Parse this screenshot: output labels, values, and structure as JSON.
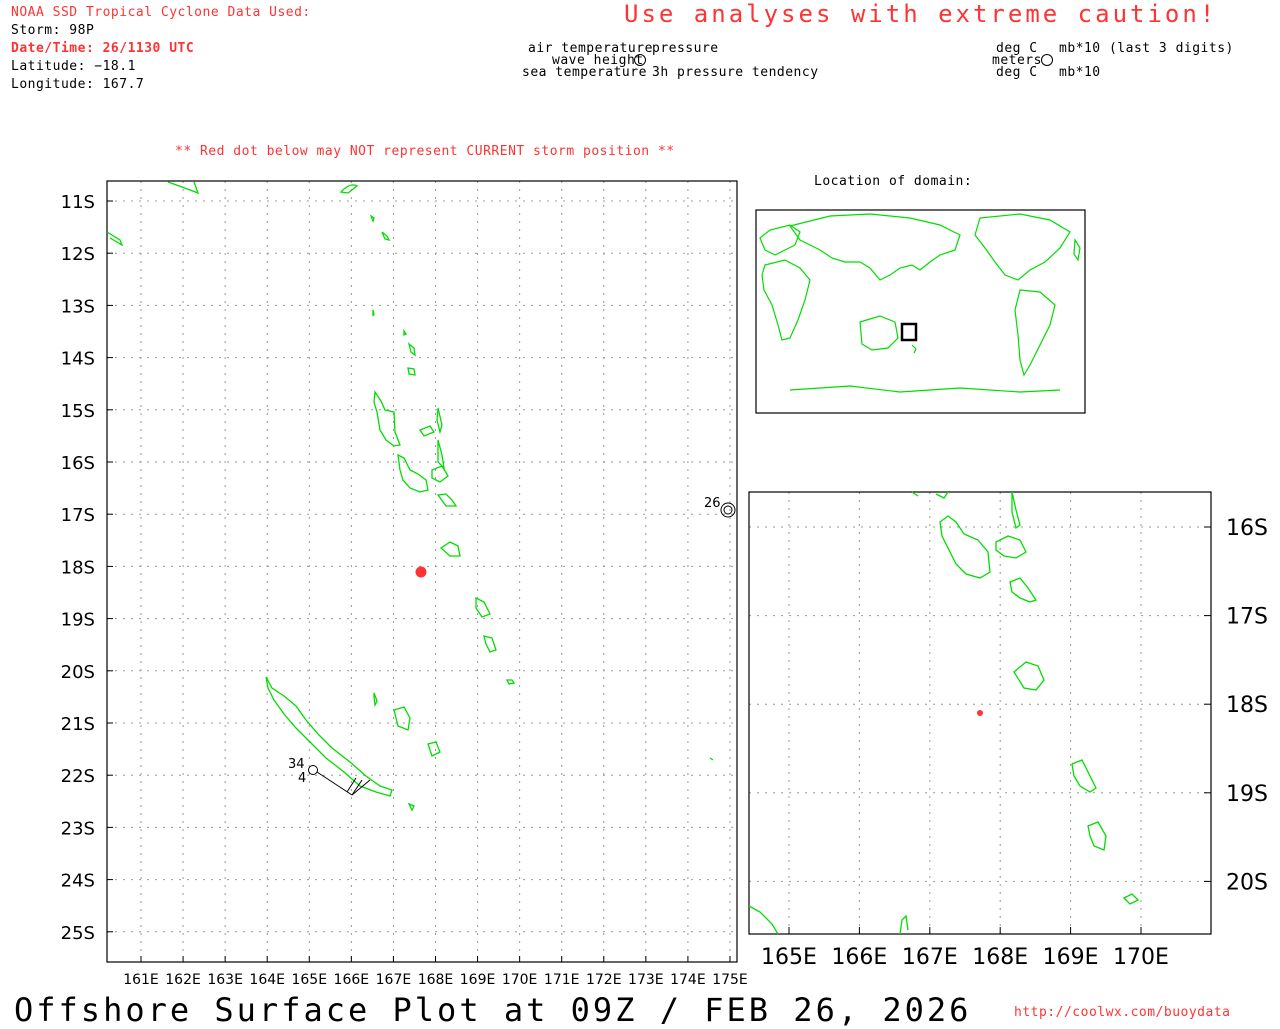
{
  "header": {
    "source_title": "NOAA SSD Tropical Cyclone Data Used:",
    "storm": "Storm: 98P",
    "datetime": "Date/Time: 26/1130 UTC",
    "latitude": "Latitude: −18.1",
    "longitude": "Longitude: 167.7",
    "caution": "Use analyses with extreme caution!",
    "red_dot_note": "** Red dot below may NOT represent CURRENT storm position **"
  },
  "legend": {
    "left_lines": [
      "air temperature",
      "wave height",
      "sea temperature"
    ],
    "right_lines": [
      "pressure",
      "",
      "3h pressure tendency"
    ],
    "units_left": [
      "deg C",
      "meters",
      "deg C"
    ],
    "units_right": [
      "mb*10 (last 3 digits)",
      "",
      "mb*10"
    ]
  },
  "inset": {
    "title": "Location of domain:"
  },
  "main_map": {
    "lon_labels": [
      "161E",
      "162E",
      "163E",
      "164E",
      "165E",
      "166E",
      "167E",
      "168E",
      "169E",
      "170E",
      "171E",
      "172E",
      "173E",
      "174E",
      "175E"
    ],
    "lat_labels": [
      "11S",
      "12S",
      "13S",
      "14S",
      "15S",
      "16S",
      "17S",
      "18S",
      "19S",
      "20S",
      "21S",
      "22S",
      "23S",
      "24S",
      "25S"
    ]
  },
  "zoom_map": {
    "lon_labels": [
      "165E",
      "166E",
      "167E",
      "168E",
      "169E",
      "170E"
    ],
    "lat_labels": [
      "16S",
      "17S",
      "18S",
      "19S",
      "20S"
    ]
  },
  "stations": [
    {
      "id": "station-a",
      "temp": "34",
      "wave": "4"
    },
    {
      "id": "station-b",
      "temp": "26"
    }
  ],
  "storm_position": {
    "lat": -18.1,
    "lon": 167.7
  },
  "colors": {
    "coast": "#00dd00",
    "storm": "#ff3333",
    "grid": "#999999"
  },
  "footer": {
    "title": "Offshore Surface Plot at 09Z / FEB 26, 2026",
    "url": "http://coolwx.com/buoydata"
  }
}
